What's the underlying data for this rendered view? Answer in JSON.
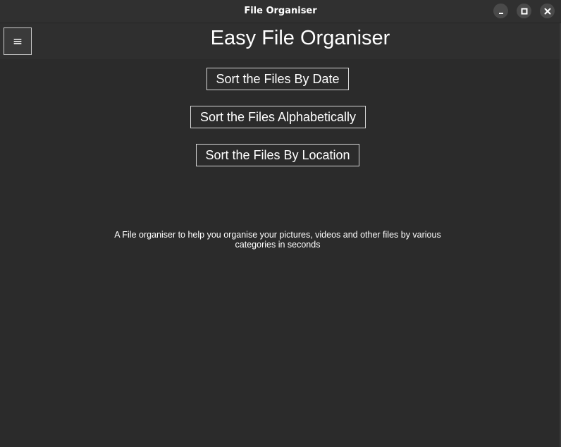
{
  "window": {
    "title": "File Organiser",
    "controls": {
      "minimize_icon": "minimize-icon",
      "maximize_icon": "maximize-icon",
      "close_icon": "close-icon"
    }
  },
  "header": {
    "menu_glyph": "≡",
    "title": "Easy File Organiser"
  },
  "actions": {
    "sort_by_date": "Sort the Files By Date",
    "sort_alphabetically": "Sort the Files Alphabetically",
    "sort_by_location": "Sort the Files By Location"
  },
  "description": "A File organiser to help you organise your pictures, videos and other files by various categories in seconds",
  "colors": {
    "background": "#2b2b2b",
    "titlebar": "#303030",
    "text": "#ffffff",
    "button_border": "#d8d8d8"
  }
}
